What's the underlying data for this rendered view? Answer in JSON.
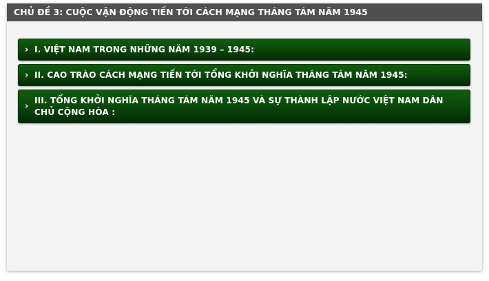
{
  "header": {
    "title": "CHỦ ĐỀ 3: CUỘC VẬN ĐỘNG TIẾN TỚI CÁCH MẠNG THÁNG TÁM NĂM 1945"
  },
  "accordion": {
    "items": [
      {
        "label": "I. VIỆT NAM TRONG NHỮNG NĂM 1939 – 1945:",
        "icon": "chevron-right-icon"
      },
      {
        "label": "II. CAO TRÀO CÁCH MẠNG TIẾN TỚI TỔNG KHỞI NGHĨA THÁNG TÁM NĂM 1945:",
        "icon": "chevron-right-icon"
      },
      {
        "label": "III. TỔNG KHỞI NGHĨA THÁNG TÁM NĂM 1945 VÀ SỰ THÀNH LẬP NƯỚC VIỆT NAM DÂN CHỦ CỘNG HÒA :",
        "icon": "chevron-right-icon"
      }
    ]
  },
  "colors": {
    "header_bg": "#505050",
    "item_bg_top": "#0f5c0f",
    "item_bg_bottom": "#032903",
    "panel_bg": "#f4f4f4"
  }
}
